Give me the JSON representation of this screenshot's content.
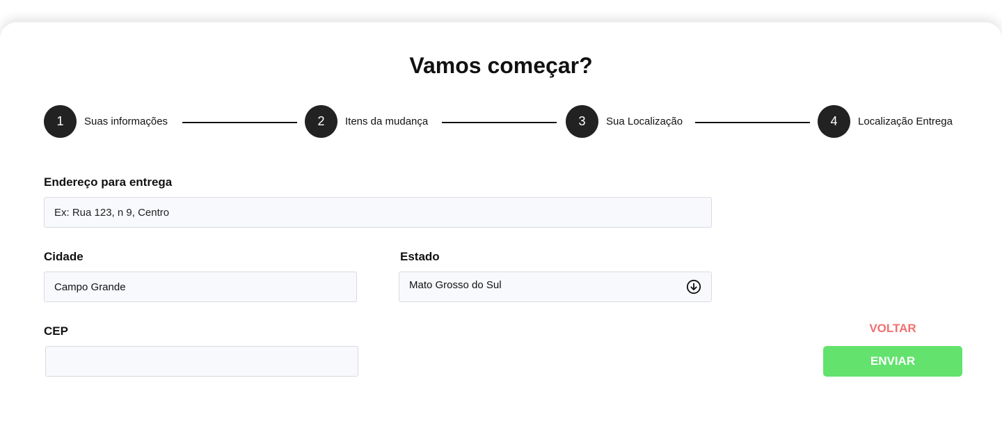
{
  "page": {
    "title": "Vamos começar?"
  },
  "steps": [
    {
      "number": "1",
      "label": "Suas informações"
    },
    {
      "number": "2",
      "label": "Itens da mudança"
    },
    {
      "number": "3",
      "label": "Sua Localização"
    },
    {
      "number": "4",
      "label": "Localização Entrega"
    }
  ],
  "form": {
    "address": {
      "label": "Endereço para entrega",
      "placeholder": "Ex: Rua 123, n 9, Centro",
      "value": ""
    },
    "city": {
      "label": "Cidade",
      "value": "Campo Grande"
    },
    "state": {
      "label": "Estado",
      "value": "Mato Grosso do Sul",
      "icon": "arrow-down-circle-icon"
    },
    "cep": {
      "label": "CEP",
      "value": ""
    }
  },
  "actions": {
    "back_label": "VOLTAR",
    "send_label": "ENVIAR"
  },
  "colors": {
    "accent_green": "#63e26e",
    "back_red": "#f07070",
    "step_dark": "#222222",
    "field_bg": "#f8f9fd"
  }
}
